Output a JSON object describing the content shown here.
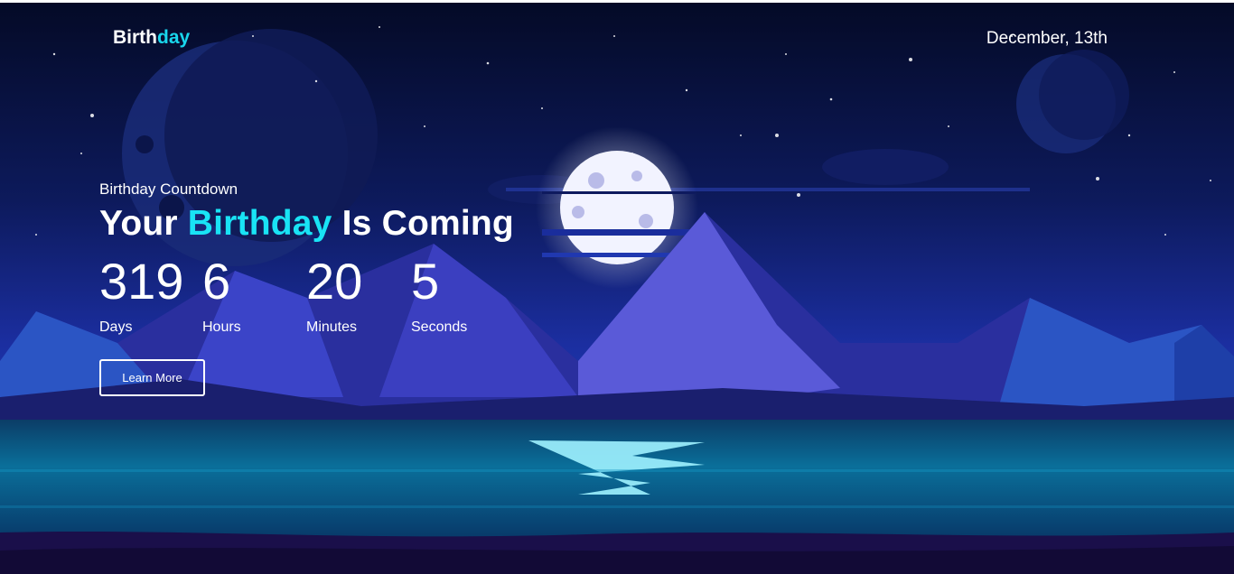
{
  "brand": {
    "part1": "Birth",
    "part2": "day"
  },
  "header": {
    "date": "December, 13th"
  },
  "hero": {
    "eyebrow": "Birthday Countdown",
    "headline_pre": "Your ",
    "headline_highlight": "Birthday",
    "headline_post": " Is Coming"
  },
  "countdown": {
    "days": {
      "value": "319",
      "label": "Days"
    },
    "hours": {
      "value": "6",
      "label": "Hours"
    },
    "minutes": {
      "value": "20",
      "label": "Minutes"
    },
    "seconds": {
      "value": "5",
      "label": "Seconds"
    }
  },
  "cta": {
    "label": "Learn More"
  },
  "colors": {
    "accent": "#19e3f5",
    "background": "#0a0f3a"
  }
}
